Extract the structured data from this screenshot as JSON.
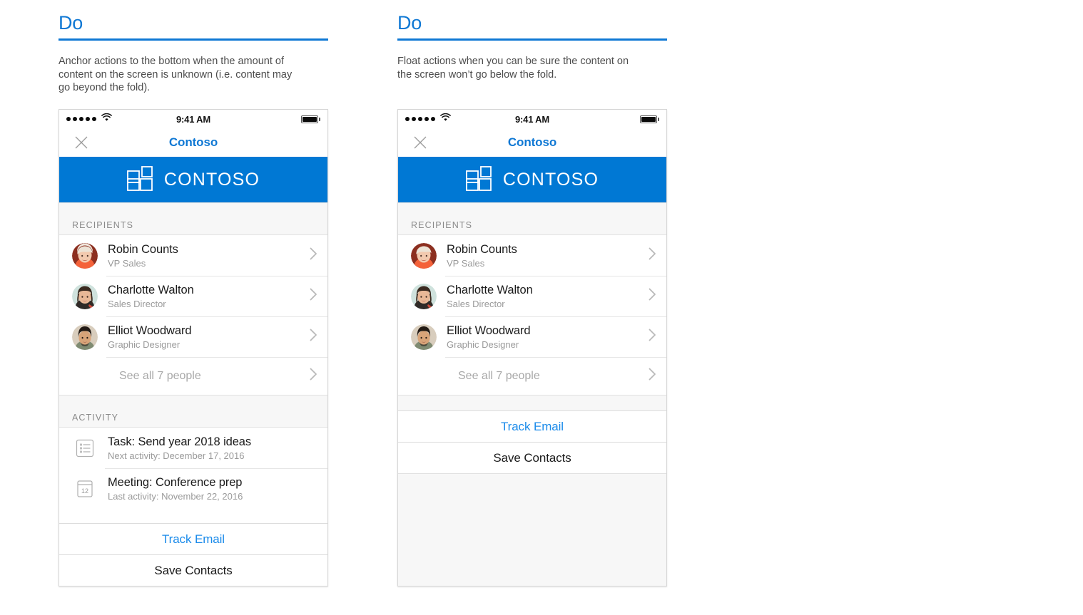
{
  "columns": [
    {
      "heading": "Do",
      "description": "Anchor actions to the bottom when the amount of content on the screen is unknown (i.e. content may go beyond the fold).",
      "variant": "anchored"
    },
    {
      "heading": "Do",
      "description": "Float actions when you can be sure the content on the screen won’t go below the fold.",
      "variant": "floating"
    }
  ],
  "phone": {
    "status_bar": {
      "signal_dots": 5,
      "wifi_icon": "wifi-icon",
      "time": "9:41 AM",
      "battery_icon": "battery-full-icon"
    },
    "nav": {
      "close_icon": "close-icon",
      "title": "Contoso"
    },
    "banner": {
      "logo_icon": "contoso-grid-logo-icon",
      "brand": "CONTOSO",
      "background": "#0078d4"
    },
    "recipients": {
      "section_label": "RECIPIENTS",
      "people": [
        {
          "name": "Robin Counts",
          "role": "VP Sales",
          "avatar": "robin-counts-avatar"
        },
        {
          "name": "Charlotte Walton",
          "role": "Sales Director",
          "avatar": "charlotte-walton-avatar"
        },
        {
          "name": "Elliot Woodward",
          "role": "Graphic Designer",
          "avatar": "elliot-woodward-avatar"
        }
      ],
      "see_all": "See all 7 people",
      "chevron_icon": "chevron-right-icon"
    },
    "activity": {
      "section_label": "ACTIVITY",
      "items": [
        {
          "title": "Task: Send year 2018 ideas",
          "sub": "Next activity: December 17, 2016",
          "icon": "task-list-icon"
        },
        {
          "title": "Meeting: Conference prep",
          "sub": "Last activity: November 22, 2016",
          "icon": "calendar-icon",
          "calendar_day": "12"
        }
      ]
    },
    "actions": {
      "primary": "Track Email",
      "secondary": "Save Contacts",
      "primary_color": "#1b8bea"
    }
  }
}
